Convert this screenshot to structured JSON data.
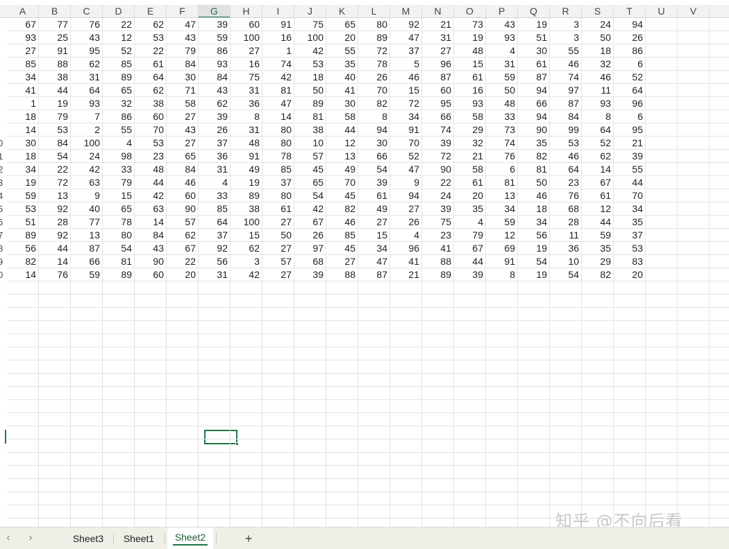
{
  "columns": [
    "A",
    "B",
    "C",
    "D",
    "E",
    "F",
    "G",
    "H",
    "I",
    "J",
    "K",
    "L",
    "M",
    "N",
    "O",
    "P",
    "Q",
    "R",
    "S",
    "T",
    "U",
    "V"
  ],
  "active_column": "G",
  "row_numbers": [
    "",
    "",
    "",
    "",
    "",
    "",
    "",
    "",
    "",
    "0",
    "1",
    "2",
    "3",
    "4",
    "5",
    "6",
    "7",
    "8",
    "9",
    "0"
  ],
  "rows": [
    [
      67,
      77,
      76,
      22,
      62,
      47,
      39,
      60,
      91,
      75,
      65,
      80,
      92,
      21,
      73,
      43,
      19,
      3,
      24,
      94
    ],
    [
      93,
      25,
      43,
      12,
      53,
      43,
      59,
      100,
      16,
      100,
      20,
      89,
      47,
      31,
      19,
      93,
      51,
      3,
      50,
      26
    ],
    [
      27,
      91,
      95,
      52,
      22,
      79,
      86,
      27,
      1,
      42,
      55,
      72,
      37,
      27,
      48,
      4,
      30,
      55,
      18,
      86
    ],
    [
      85,
      88,
      62,
      85,
      61,
      84,
      93,
      16,
      74,
      53,
      35,
      78,
      5,
      96,
      15,
      31,
      61,
      46,
      32,
      6
    ],
    [
      34,
      38,
      31,
      89,
      64,
      30,
      84,
      75,
      42,
      18,
      40,
      26,
      46,
      87,
      61,
      59,
      87,
      74,
      46,
      52
    ],
    [
      41,
      44,
      64,
      65,
      62,
      71,
      43,
      31,
      81,
      50,
      41,
      70,
      15,
      60,
      16,
      50,
      94,
      97,
      11,
      64
    ],
    [
      1,
      19,
      93,
      32,
      38,
      58,
      62,
      36,
      47,
      89,
      30,
      82,
      72,
      95,
      93,
      48,
      66,
      87,
      93,
      96
    ],
    [
      18,
      79,
      7,
      86,
      60,
      27,
      39,
      8,
      14,
      81,
      58,
      8,
      34,
      66,
      58,
      33,
      94,
      84,
      8,
      6
    ],
    [
      14,
      53,
      2,
      55,
      70,
      43,
      26,
      31,
      80,
      38,
      44,
      94,
      91,
      74,
      29,
      73,
      90,
      99,
      64,
      95
    ],
    [
      30,
      84,
      100,
      4,
      53,
      27,
      37,
      48,
      80,
      10,
      12,
      30,
      70,
      39,
      32,
      74,
      35,
      53,
      52,
      21
    ],
    [
      18,
      54,
      24,
      98,
      23,
      65,
      36,
      91,
      78,
      57,
      13,
      66,
      52,
      72,
      21,
      76,
      82,
      46,
      62,
      39
    ],
    [
      34,
      22,
      42,
      33,
      48,
      84,
      31,
      49,
      85,
      45,
      49,
      54,
      47,
      90,
      58,
      6,
      81,
      64,
      14,
      55
    ],
    [
      19,
      72,
      63,
      79,
      44,
      46,
      4,
      19,
      37,
      65,
      70,
      39,
      9,
      22,
      61,
      81,
      50,
      23,
      67,
      44
    ],
    [
      59,
      13,
      9,
      15,
      42,
      60,
      33,
      89,
      80,
      54,
      45,
      61,
      94,
      24,
      20,
      13,
      46,
      76,
      61,
      70
    ],
    [
      53,
      92,
      40,
      65,
      63,
      90,
      85,
      38,
      61,
      42,
      82,
      49,
      27,
      39,
      35,
      34,
      18,
      68,
      12,
      34
    ],
    [
      51,
      28,
      77,
      78,
      14,
      57,
      64,
      100,
      27,
      67,
      46,
      27,
      26,
      75,
      4,
      59,
      34,
      28,
      44,
      35
    ],
    [
      89,
      92,
      13,
      80,
      84,
      62,
      37,
      15,
      50,
      26,
      85,
      15,
      4,
      23,
      79,
      12,
      56,
      11,
      59,
      37
    ],
    [
      56,
      44,
      87,
      54,
      43,
      67,
      92,
      62,
      27,
      97,
      45,
      34,
      96,
      41,
      67,
      69,
      19,
      36,
      35,
      53
    ],
    [
      82,
      14,
      66,
      81,
      90,
      22,
      56,
      3,
      57,
      68,
      27,
      47,
      41,
      88,
      44,
      91,
      54,
      10,
      29,
      83
    ],
    [
      14,
      76,
      59,
      89,
      60,
      20,
      31,
      42,
      27,
      39,
      88,
      87,
      21,
      89,
      39,
      8,
      19,
      54,
      82,
      20
    ]
  ],
  "sheet_tabs": {
    "prev_arrow": "‹",
    "next_arrow": "›",
    "tabs": [
      "Sheet3",
      "Sheet1",
      "Sheet2"
    ],
    "active_tab": "Sheet2",
    "add_label": "+"
  },
  "watermark": "知乎 @不向后看",
  "colors": {
    "accent": "#217346",
    "gridline": "#e4e4e4",
    "header_bg": "#f2f2f2"
  }
}
